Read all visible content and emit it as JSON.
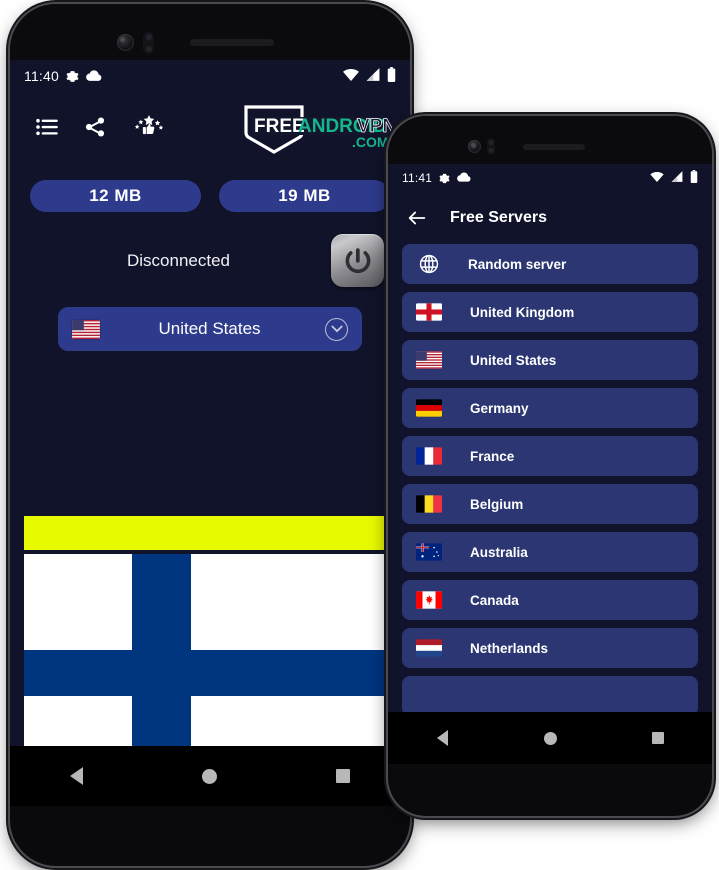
{
  "phone1": {
    "status_bar": {
      "time": "11:40",
      "icons_left": [
        "gear-icon",
        "cloud-icon"
      ],
      "icons_right": [
        "wifi-icon",
        "signal-icon",
        "battery-icon"
      ]
    },
    "toolbar": {
      "icons": [
        {
          "name": "list-menu-icon",
          "label": "Menu"
        },
        {
          "name": "share-icon",
          "label": "Share"
        },
        {
          "name": "rate-stars-icon",
          "label": "Rate"
        }
      ]
    },
    "logo": {
      "part1": "FREE",
      "part2": "ANDROID",
      "part3": "VPN",
      "part4": ".COM",
      "color1": "#ffffff",
      "color2": "#15b68c",
      "color3": "#14162e",
      "color4": "#15b68c"
    },
    "usage": {
      "download": "12 MB",
      "upload": "19 MB",
      "pill_color": "#2e3a8c"
    },
    "connection": {
      "status": "Disconnected",
      "power_button": "power-button"
    },
    "server_select": {
      "flag": "us-flag",
      "label": "United States",
      "chevron": "chevron-down-icon"
    },
    "banner": {
      "bar_color": "#e8fa00",
      "flag": "finland-flag",
      "flag_white": "#ffffff",
      "flag_blue": "#003580"
    },
    "nav": [
      "back-nav-button",
      "home-nav-button",
      "recents-nav-button"
    ]
  },
  "phone2": {
    "status_bar": {
      "time": "11:41",
      "icons_left": [
        "gear-icon",
        "cloud-icon"
      ],
      "icons_right": [
        "wifi-icon",
        "signal-icon",
        "battery-icon"
      ]
    },
    "appbar": {
      "back": "back-arrow-icon",
      "title": "Free Servers"
    },
    "servers": [
      {
        "flag": "globe",
        "label": "Random server"
      },
      {
        "flag": "gb",
        "label": "United Kingdom"
      },
      {
        "flag": "us",
        "label": "United States"
      },
      {
        "flag": "de",
        "label": "Germany"
      },
      {
        "flag": "fr",
        "label": "France"
      },
      {
        "flag": "be",
        "label": "Belgium"
      },
      {
        "flag": "au",
        "label": "Australia"
      },
      {
        "flag": "ca",
        "label": "Canada"
      },
      {
        "flag": "nl",
        "label": "Netherlands"
      },
      {
        "flag": "partial",
        "label": ""
      }
    ],
    "row_color": "#2b3672",
    "nav": [
      "back-nav-button",
      "home-nav-button",
      "recents-nav-button"
    ]
  },
  "theme": {
    "screen_bg": "#11132b",
    "accent_blue": "#2e3a8c",
    "row_blue": "#2b3672",
    "yellow": "#e8fa00",
    "flag_blue": "#003580"
  }
}
